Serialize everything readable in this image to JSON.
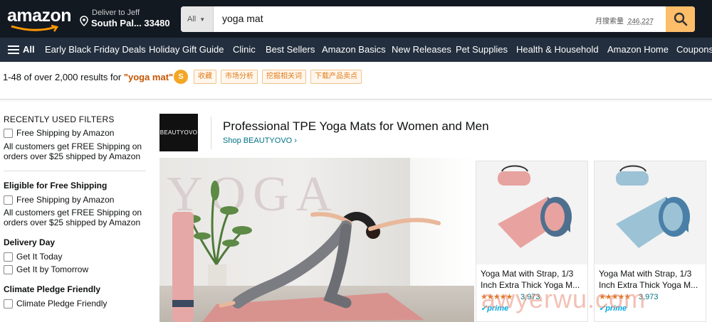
{
  "header": {
    "logo_text": "amazon",
    "deliver_line1": "Deliver to Jeff",
    "deliver_line2": "South Pal... 33480",
    "search": {
      "category": "All",
      "query": "yoga mat",
      "monthly_volume_label": "月搜索量",
      "monthly_volume_value": "246,227"
    }
  },
  "nav": {
    "all_label": "All",
    "items": [
      "Early Black Friday Deals",
      "Holiday Gift Guide",
      "Clinic",
      "Best Sellers",
      "Amazon Basics",
      "New Releases",
      "Pet Supplies",
      "Health & Household",
      "Amazon Home",
      "Coupons"
    ]
  },
  "results": {
    "count_prefix": "1-48 of over 2,000 results for ",
    "keyword": "\"yoga mat\"",
    "toolbar_logo": "S",
    "toolbar_chips": [
      "收藏",
      "市场分析",
      "挖掘相关词",
      "下载产品卖点"
    ]
  },
  "sidebar": {
    "recent_heading": "RECENTLY USED FILTERS",
    "recent_option": "Free Shipping by Amazon",
    "recent_note": "All customers get FREE Shipping on orders over $25 shipped by Amazon",
    "free_heading": "Eligible for Free Shipping",
    "free_option": "Free Shipping by Amazon",
    "free_note": "All customers get FREE Shipping on orders over $25 shipped by Amazon",
    "delivery_heading": "Delivery Day",
    "delivery_options": [
      "Get It Today",
      "Get It by Tomorrow"
    ],
    "climate_heading": "Climate Pledge Friendly",
    "climate_option": "Climate Pledge Friendly"
  },
  "sponsored": {
    "brand_logo_text": "BEAUTYOVO",
    "headline": "Professional TPE Yoga Mats for Women and Men",
    "shop_link": "Shop BEAUTYOVO ›",
    "hero_text": "YOGA"
  },
  "products": [
    {
      "title": "Yoga Mat with Strap, 1/3 Inch Extra Thick Yoga M...",
      "stars": "★★★★★",
      "reviews": "3,973",
      "prime": "✓prime",
      "mat_color": "#e8a3a0",
      "mat_inner_color": "#4f6f8f"
    },
    {
      "title": "Yoga Mat with Strap, 1/3 Inch Extra Thick Yoga M...",
      "stars": "★★★★★",
      "reviews": "3,973",
      "prime": "✓prime",
      "mat_color": "#9cc2d6",
      "mat_inner_color": "#4a7fa8"
    }
  ],
  "watermark": "awyerwu.com",
  "colors": {
    "header_bg": "#131921",
    "nav_bg": "#232f3e",
    "search_button": "#febd69",
    "keyword": "#c45500",
    "link": "#007185"
  }
}
